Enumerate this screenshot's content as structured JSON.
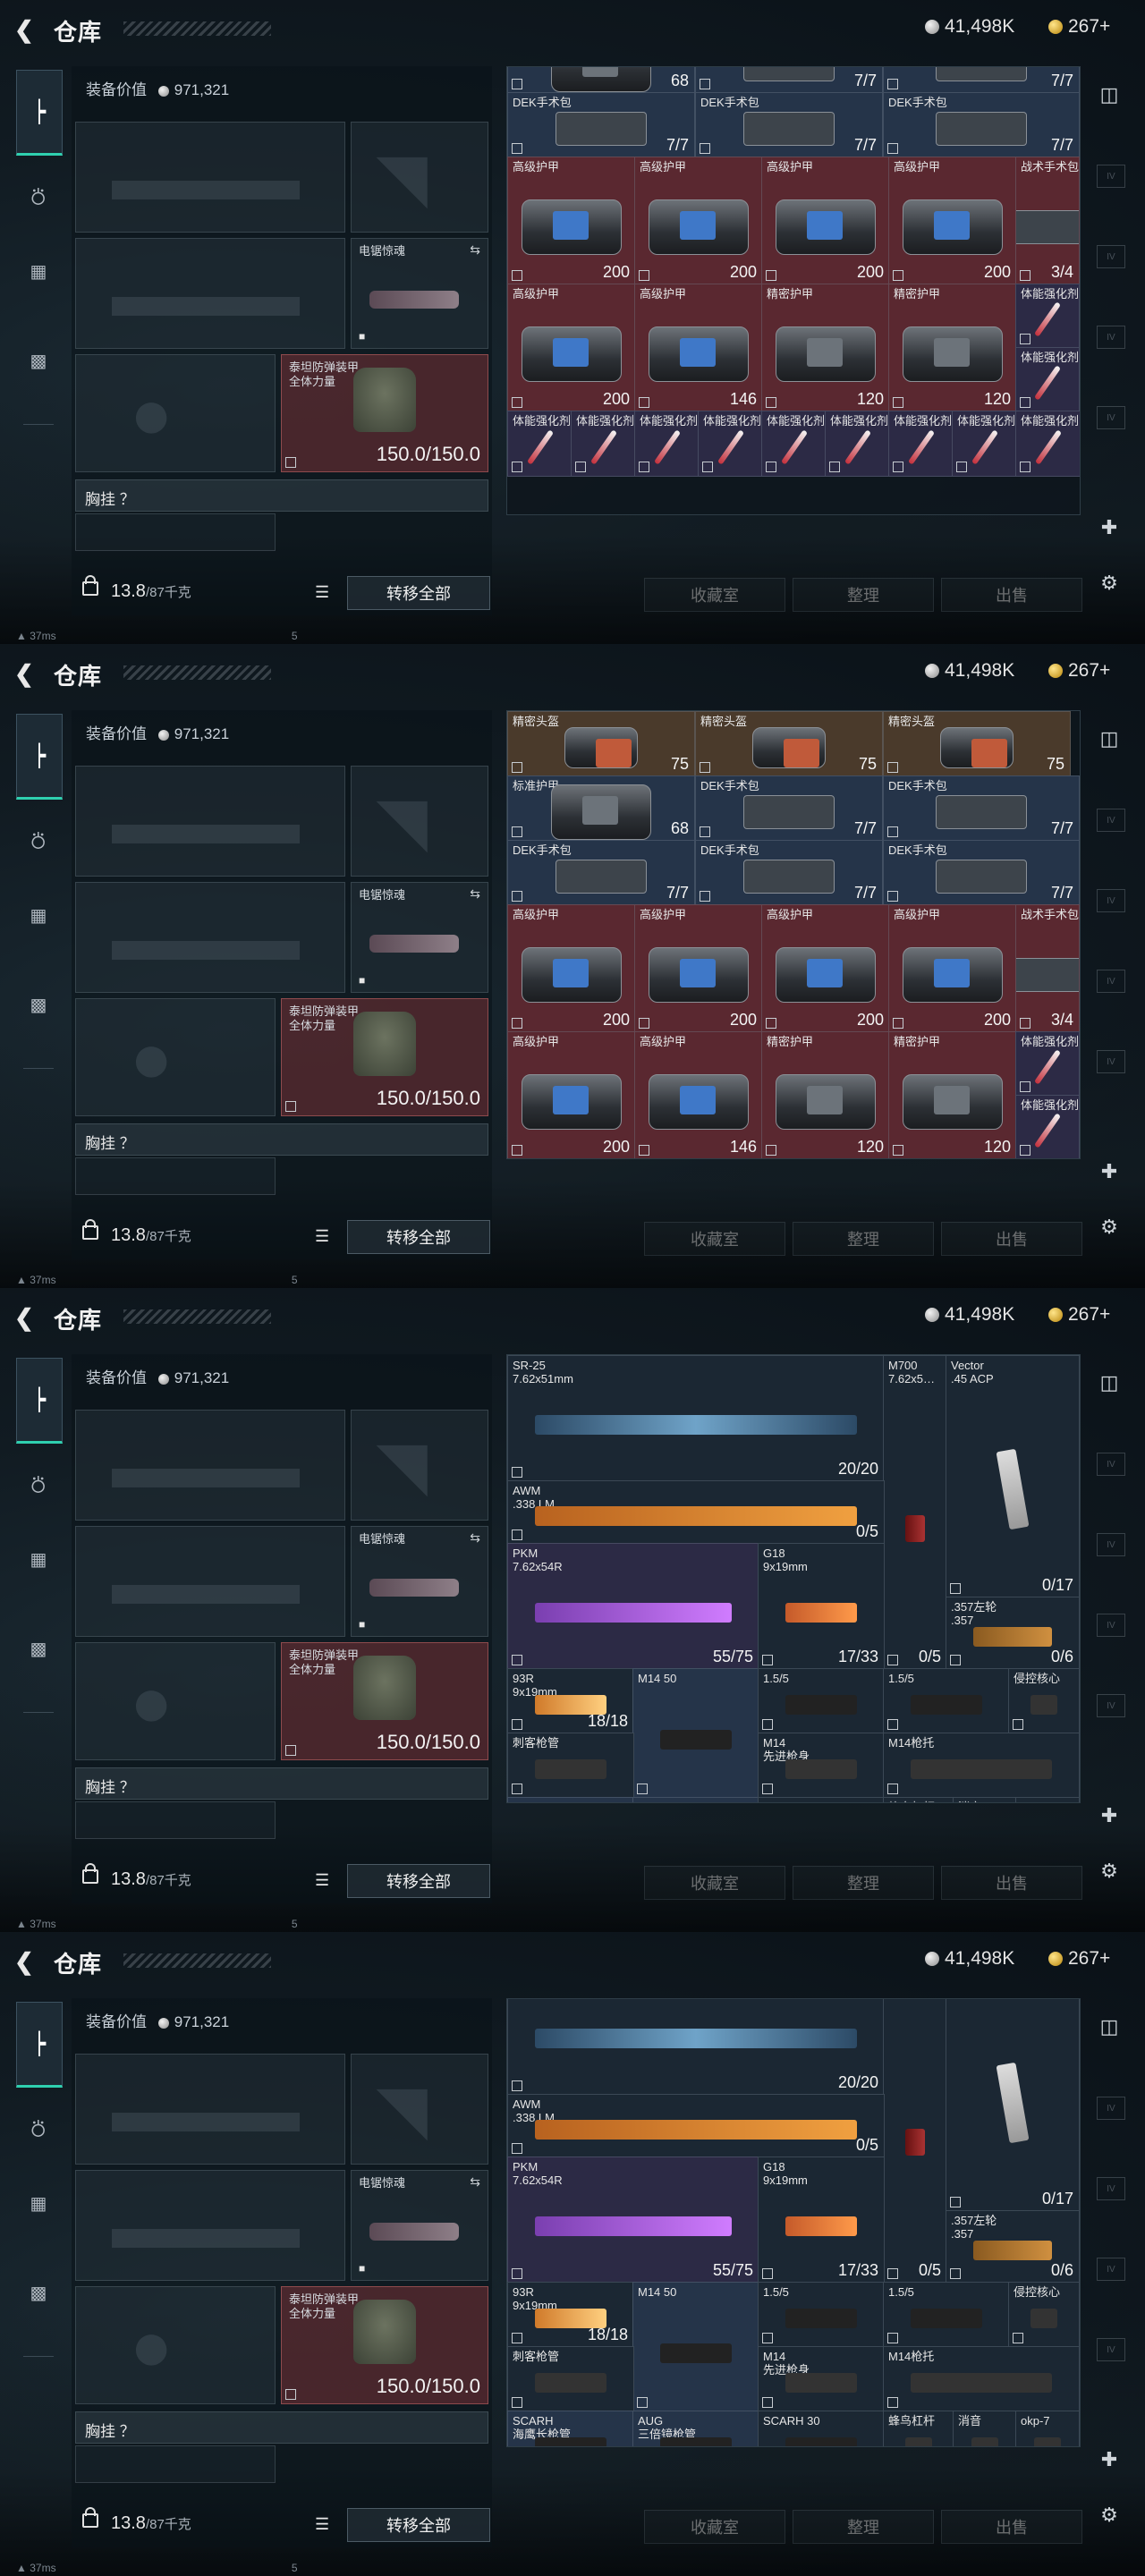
{
  "header": {
    "title": "仓库",
    "silver": "41,498K",
    "gold": "267+"
  },
  "loadout": {
    "equip_value_label": "装备价值",
    "equip_value": "971,321",
    "melee_label": "电锯惊魂",
    "vest_label": "泰坦防弹装甲\n全体力量",
    "vest_durability": "150.0/150.0",
    "chest_label": "胸挂 ？",
    "weight_value": "13.8",
    "weight_unit": "/87千克",
    "transfer_all": "转移全部"
  },
  "actions": {
    "collection": "收藏室",
    "sort": "整理",
    "sell": "出售"
  },
  "status_bar": {
    "ping": "37ms",
    "page": "5"
  },
  "screens": [
    {
      "armor_top_row": [
        "75",
        "75"
      ],
      "rows": [
        [
          {
            "name": "标准护甲",
            "count": "68",
            "color": "c-blue",
            "art": "bag-grey"
          },
          {
            "name": "DEK手术包",
            "count": "7/7",
            "color": "c-blue",
            "art": "case"
          },
          {
            "name": "DEK手术包",
            "count": "7/7",
            "color": "c-blue",
            "art": "case"
          }
        ],
        [
          {
            "name": "DEK手术包",
            "count": "7/7",
            "color": "c-blue",
            "art": "case"
          },
          {
            "name": "DEK手术包",
            "count": "7/7",
            "color": "c-blue",
            "art": "case"
          },
          {
            "name": "DEK手术包",
            "count": "7/7",
            "color": "c-blue",
            "art": "case"
          }
        ],
        [
          {
            "name": "高级护甲",
            "count": "200",
            "color": "c-red",
            "art": "bag"
          },
          {
            "name": "高级护甲",
            "count": "200",
            "color": "c-red",
            "art": "bag"
          },
          {
            "name": "高级护甲",
            "count": "200",
            "color": "c-red",
            "art": "bag"
          },
          {
            "name": "高级护甲",
            "count": "200",
            "color": "c-red",
            "art": "bag"
          }
        ],
        [
          {
            "name": "高级护甲",
            "count": "200",
            "color": "c-red",
            "art": "bag"
          },
          {
            "name": "高级护甲",
            "count": "146",
            "color": "c-red",
            "art": "bag"
          },
          {
            "name": "精密护甲",
            "count": "120",
            "color": "c-red",
            "art": "bag-grey"
          },
          {
            "name": "精密护甲",
            "count": "120",
            "color": "c-red",
            "art": "bag-grey"
          }
        ]
      ],
      "tall_item": {
        "name": "战术手术包",
        "count": "3/4"
      },
      "side_labels": [
        "体能强化剂",
        "体能强化剂"
      ],
      "syringe_label": "体能强化剂"
    },
    {
      "rows_top": [
        {
          "name": "精密头盔",
          "count": "75",
          "color": "c-brown",
          "art": "bag-orange"
        },
        {
          "name": "精密头盔",
          "count": "75",
          "color": "c-brown",
          "art": "bag-orange"
        },
        {
          "name": "精密头盔",
          "count": "75",
          "color": "c-brown",
          "art": "bag-orange"
        }
      ]
    },
    {
      "weapons": {
        "sr25": {
          "name": "SR-25",
          "cal": "7.62x51mm",
          "count": "20/20"
        },
        "m700": {
          "name": "M700",
          "cal": "7.62x5…"
        },
        "vector": {
          "name": "Vector",
          "cal": ".45 ACP",
          "count": "0/17"
        },
        "awm": {
          "name": "AWM",
          "cal": ".338 LM",
          "count": "0/5"
        },
        "pkm": {
          "name": "PKM",
          "cal": "7.62x54R",
          "count": "55/75"
        },
        "g18": {
          "name": "G18",
          "cal": "9x19mm",
          "count": "17/33"
        },
        "m700_count": "0/5",
        "rev": {
          "name": ".357左轮",
          "cal": ".357",
          "count": "0/6"
        },
        "r93": {
          "name": "93R",
          "cal": "9x19mm",
          "count": "18/18"
        },
        "m14mag": {
          "name": "M14 50"
        },
        "scope1": {
          "name": "1.5/5"
        },
        "scope2": {
          "name": "1.5/5"
        },
        "grip": {
          "name": "侵控核心"
        },
        "stab": {
          "name": "刺客枪管"
        },
        "m14": {
          "name": "M14",
          "cal": "先进枪身"
        },
        "m14stock": {
          "name": "M14枪托"
        },
        "scarh": {
          "name": "SCARH",
          "cal": "海鹰长枪管"
        },
        "aug": {
          "name": "AUG",
          "cal": "三倍镜枪管"
        },
        "scar30": {
          "name": "SCARH 30"
        },
        "bee": {
          "name": "蜂鸟杠杆"
        },
        "muzzle": {
          "name": "消音"
        },
        "okp": {
          "name": "okp-7"
        }
      }
    }
  ],
  "colors": {
    "accent": "#2fd0b0",
    "armor_red": "#5a2830",
    "item_blue": "#253449"
  }
}
